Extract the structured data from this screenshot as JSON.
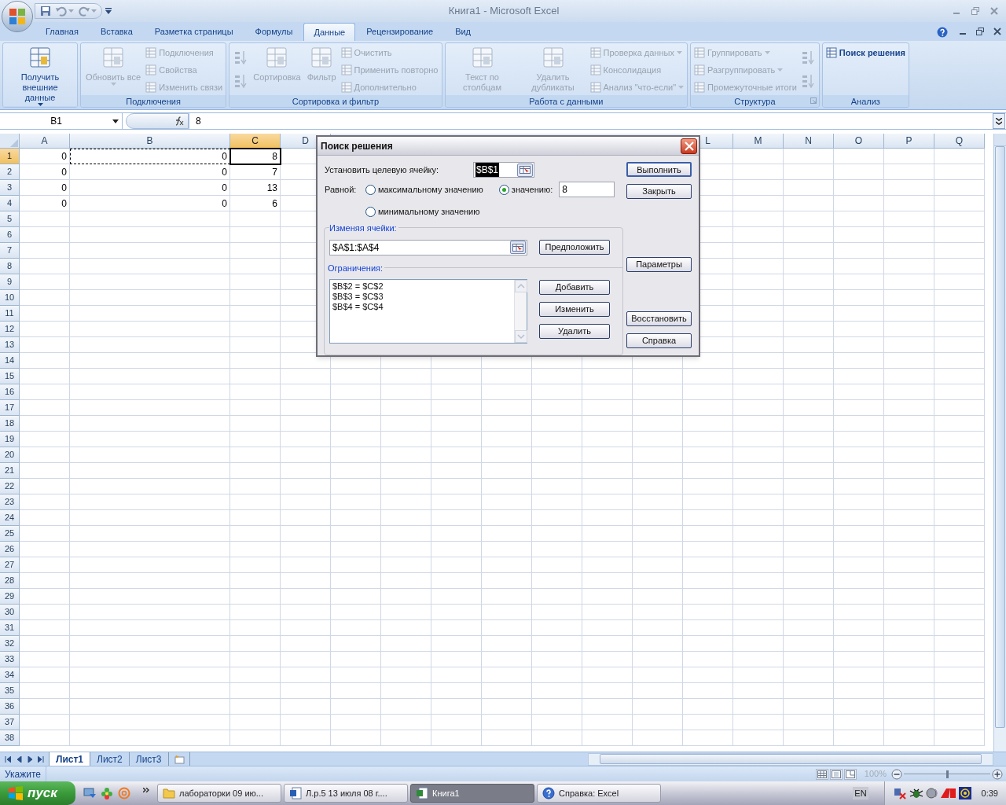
{
  "window": {
    "title": "Книга1 - Microsoft Excel"
  },
  "ribbon": {
    "tabs": [
      {
        "label": "Главная",
        "selected": false
      },
      {
        "label": "Вставка",
        "selected": false
      },
      {
        "label": "Разметка страницы",
        "selected": false
      },
      {
        "label": "Формулы",
        "selected": false
      },
      {
        "label": "Данные",
        "selected": true
      },
      {
        "label": "Рецензирование",
        "selected": false
      },
      {
        "label": "Вид",
        "selected": false
      }
    ],
    "groups": [
      {
        "columns": [
          [
            {
              "kind": "large",
              "label": "Получить внешние данные",
              "disabled": false,
              "dropdown": true
            }
          ]
        ]
      },
      {
        "label": "Подключения",
        "columns": [
          [
            {
              "kind": "large",
              "label": "Обновить все",
              "disabled": true,
              "dropdown": true
            }
          ],
          [
            {
              "kind": "small",
              "label": "Подключения",
              "disabled": true,
              "dropdown": false
            },
            {
              "kind": "small",
              "label": "Свойства",
              "disabled": true,
              "dropdown": false
            },
            {
              "kind": "small",
              "label": "Изменить связи",
              "disabled": true,
              "dropdown": false
            }
          ]
        ]
      },
      {
        "label": "Сортировка и фильтр",
        "columns": [
          [
            {
              "kind": "icon",
              "disabled": true
            },
            {
              "kind": "icon",
              "disabled": true
            }
          ],
          [
            {
              "kind": "large",
              "label": "Сортировка",
              "disabled": true,
              "dropdown": false
            }
          ],
          [
            {
              "kind": "large",
              "label": "Фильтр",
              "disabled": true,
              "dropdown": false
            }
          ],
          [
            {
              "kind": "small",
              "label": "Очистить",
              "disabled": true,
              "dropdown": false
            },
            {
              "kind": "small",
              "label": "Применить повторно",
              "disabled": true,
              "dropdown": false
            },
            {
              "kind": "small",
              "label": "Дополнительно",
              "disabled": true,
              "dropdown": false
            }
          ]
        ]
      },
      {
        "label": "Работа с данными",
        "columns": [
          [
            {
              "kind": "large",
              "label": "Текст по столбцам",
              "disabled": true,
              "dropdown": false
            }
          ],
          [
            {
              "kind": "large",
              "label": "Удалить дубликаты",
              "disabled": true,
              "dropdown": false
            }
          ],
          [
            {
              "kind": "small",
              "label": "Проверка данных",
              "disabled": true,
              "dropdown": true
            },
            {
              "kind": "small",
              "label": "Консолидация",
              "disabled": true,
              "dropdown": false
            },
            {
              "kind": "small",
              "label": "Анализ \"что-если\"",
              "disabled": true,
              "dropdown": true
            }
          ]
        ]
      },
      {
        "label": "Структура",
        "launcher": true,
        "columns": [
          [
            {
              "kind": "small",
              "label": "Группировать",
              "disabled": true,
              "dropdown": true
            },
            {
              "kind": "small",
              "label": "Разгруппировать",
              "disabled": true,
              "dropdown": true
            },
            {
              "kind": "small",
              "label": "Промежуточные итоги",
              "disabled": true,
              "dropdown": false
            }
          ],
          [
            {
              "kind": "icon",
              "disabled": true
            },
            {
              "kind": "icon",
              "disabled": true
            }
          ]
        ]
      },
      {
        "label": "Анализ",
        "columns": [
          [
            {
              "kind": "small",
              "label": "Поиск решения",
              "disabled": false,
              "dropdown": false
            }
          ]
        ]
      }
    ]
  },
  "formula_bar": {
    "name_box": "B1",
    "formula": "8"
  },
  "sheet": {
    "columns": [
      {
        "label": "A",
        "selected": false
      },
      {
        "label": "B",
        "selected": false
      },
      {
        "label": "C",
        "selected": true
      },
      {
        "label": "D",
        "selected": false
      },
      {
        "label": "L",
        "selected": false
      },
      {
        "label": "M",
        "selected": false
      },
      {
        "label": "N",
        "selected": false
      },
      {
        "label": "O",
        "selected": false
      },
      {
        "label": "P",
        "selected": false
      },
      {
        "label": "Q",
        "selected": false
      }
    ],
    "rows": [
      {
        "label": "1",
        "selected": true,
        "cells": [
          {
            "value": "0",
            "active": false,
            "marquee": false
          },
          {
            "value": "0",
            "active": false,
            "marquee": true
          },
          {
            "value": "8",
            "active": true,
            "marquee": false
          }
        ]
      },
      {
        "label": "2",
        "selected": false,
        "cells": [
          {
            "value": "0",
            "active": false,
            "marquee": false
          },
          {
            "value": "0",
            "active": false,
            "marquee": false
          },
          {
            "value": "7",
            "active": false,
            "marquee": false
          }
        ]
      },
      {
        "label": "3",
        "selected": false,
        "cells": [
          {
            "value": "0",
            "active": false,
            "marquee": false
          },
          {
            "value": "0",
            "active": false,
            "marquee": false
          },
          {
            "value": "13",
            "active": false,
            "marquee": false
          }
        ]
      },
      {
        "label": "4",
        "selected": false,
        "cells": [
          {
            "value": "0",
            "active": false,
            "marquee": false
          },
          {
            "value": "0",
            "active": false,
            "marquee": false
          },
          {
            "value": "6",
            "active": false,
            "marquee": false
          }
        ]
      },
      {
        "label": "5",
        "selected": false
      },
      {
        "label": "6",
        "selected": false
      },
      {
        "label": "7",
        "selected": false
      },
      {
        "label": "8",
        "selected": false
      },
      {
        "label": "9",
        "selected": false
      },
      {
        "label": "10",
        "selected": false
      },
      {
        "label": "11",
        "selected": false
      },
      {
        "label": "12",
        "selected": false
      },
      {
        "label": "13",
        "selected": false
      },
      {
        "label": "14",
        "selected": false
      },
      {
        "label": "15",
        "selected": false
      },
      {
        "label": "16",
        "selected": false
      },
      {
        "label": "17",
        "selected": false
      },
      {
        "label": "18",
        "selected": false
      },
      {
        "label": "19",
        "selected": false
      },
      {
        "label": "20",
        "selected": false
      },
      {
        "label": "21",
        "selected": false
      },
      {
        "label": "22",
        "selected": false
      },
      {
        "label": "23",
        "selected": false
      },
      {
        "label": "24",
        "selected": false
      },
      {
        "label": "25",
        "selected": false
      },
      {
        "label": "26",
        "selected": false
      },
      {
        "label": "27",
        "selected": false
      },
      {
        "label": "28",
        "selected": false
      },
      {
        "label": "29",
        "selected": false
      },
      {
        "label": "30",
        "selected": false
      },
      {
        "label": "31",
        "selected": false
      },
      {
        "label": "32",
        "selected": false
      },
      {
        "label": "33",
        "selected": false
      },
      {
        "label": "34",
        "selected": false
      },
      {
        "label": "35",
        "selected": false
      },
      {
        "label": "36",
        "selected": false
      },
      {
        "label": "37",
        "selected": false
      },
      {
        "label": "38",
        "selected": false
      }
    ],
    "tabs": [
      {
        "label": "Лист1",
        "selected": true
      },
      {
        "label": "Лист2",
        "selected": false
      },
      {
        "label": "Лист3",
        "selected": false
      }
    ]
  },
  "dialog": {
    "title": "Поиск решения",
    "target_label": "Установить целевую ячейку:",
    "target_value": "$B$1",
    "equal_label": "Равной:",
    "radios": [
      {
        "label": "максимальному значению",
        "selected": false
      },
      {
        "label": "значению:",
        "selected": true
      },
      {
        "label": "минимальному значению",
        "selected": false
      }
    ],
    "value_field": "8",
    "changing_label": "Изменяя ячейки:",
    "changing_value": "$A$1:$A$4",
    "guess_button": "Предположить",
    "constraints_label": "Ограничения:",
    "constraints": [
      "$B$2 = $C$2",
      "$B$3 = $C$3",
      "$B$4 = $C$4"
    ],
    "constraint_buttons": [
      "Добавить",
      "Изменить",
      "Удалить"
    ],
    "side_buttons": [
      {
        "label": "Выполнить",
        "default": true
      },
      {
        "label": "Закрыть",
        "default": false
      },
      {
        "label": "Параметры",
        "default": false
      },
      {
        "label": "Восстановить",
        "default": false
      },
      {
        "label": "Справка",
        "default": false
      }
    ]
  },
  "status_bar": {
    "text": "Укажите",
    "zoom": "100%",
    "level": 0.5
  },
  "taskbar": {
    "start": "пуск",
    "tasks": [
      {
        "kind": "folder",
        "label": "лабораторки 09 ию...",
        "selected": false
      },
      {
        "kind": "word",
        "label": "Л.р.5  13 июля 08 г....",
        "selected": false
      },
      {
        "kind": "excel",
        "label": "Книга1",
        "selected": true
      },
      {
        "kind": "help",
        "label": "Справка: Excel",
        "selected": false
      }
    ],
    "language": "EN",
    "clock": "0:39"
  }
}
